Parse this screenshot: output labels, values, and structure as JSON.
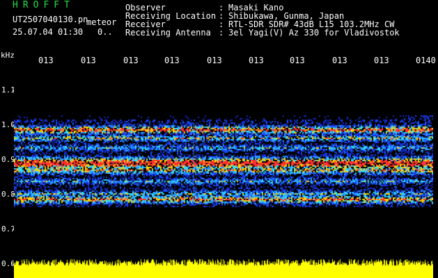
{
  "header": {
    "app_title": "HROFFT",
    "filename": "UT2507040130.pn",
    "meteor_label": "meteor",
    "datetime": "25.07.04 01:30",
    "count": "0.."
  },
  "info": [
    {
      "key": "Observer",
      "sep": ":",
      "value": "Masaki Kano"
    },
    {
      "key": "Receiving Location",
      "sep": ":",
      "value": "Shibukawa, Gunma, Japan"
    },
    {
      "key": "Receiver",
      "sep": ":",
      "value": "RTL-SDR SDR# 43dB L15 103.2MHz CW"
    },
    {
      "key": "Receiving Antenna",
      "sep": ":",
      "value": "3el Yagi(V) Az 330 for Vladivostok"
    }
  ],
  "axis": {
    "unit": "kHz",
    "time_ticks": [
      "013",
      "013",
      "013",
      "013",
      "013",
      "013",
      "013",
      "013",
      "013",
      "0140"
    ],
    "freq_ticks": [
      "1.1",
      "1.0",
      "0.9",
      "0.8",
      "0.7",
      "0.6"
    ]
  },
  "colors": {
    "background": "#000000",
    "axis_text": "#ffffff",
    "title_green": "#22e04a",
    "noise_blue": "#1a3cff",
    "signal_yellow": "#ffff00"
  }
}
